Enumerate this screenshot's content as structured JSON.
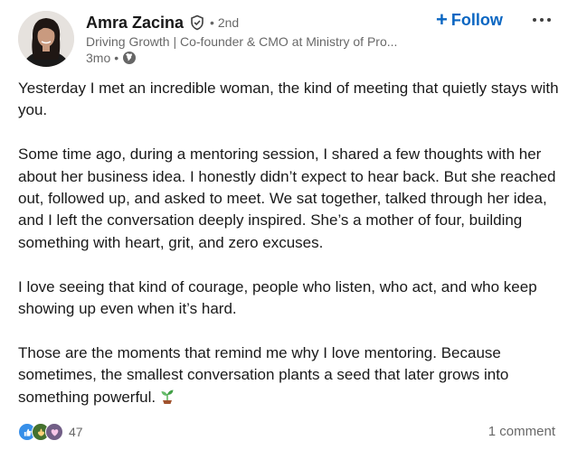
{
  "author": {
    "name": "Amra Zacina",
    "degree": "• 2nd",
    "headline": "Driving Growth | Co-founder & CMO at Ministry of Pro...",
    "time": "3mo",
    "meta_separator": "•",
    "verified_icon": "verified-shield-icon",
    "visibility_icon": "globe-icon"
  },
  "actions": {
    "follow_label": "Follow",
    "follow_icon": "+",
    "more_icon": "ellipsis-icon"
  },
  "post": {
    "paragraphs": [
      "Yesterday I met an incredible woman, the kind of meeting that quietly stays with you.",
      "Some time ago, during a mentoring session, I shared a few thoughts with her about her business idea. I honestly didn’t expect to hear back. But she reached out, followed up, and asked to meet. We sat together, talked through her idea, and I left the conversation deeply inspired. She’s a mother of four, building something with heart, grit, and zero excuses.",
      "I love seeing that kind of courage, people who listen, who act, and who keep showing up even when it’s hard.",
      "Those are the moments that remind me why I love mentoring. Because sometimes, the smallest conversation plants a seed that later grows into something powerful."
    ],
    "trailing_emoji": "seedling-icon"
  },
  "social": {
    "reactions": [
      "like-icon",
      "celebrate-icon",
      "support-icon"
    ],
    "reaction_count": "47",
    "comment_count": "1 comment"
  },
  "colors": {
    "accent": "#0a66c2",
    "like": "#378fe9",
    "celebrate": "#44712e",
    "support": "#715e86"
  }
}
